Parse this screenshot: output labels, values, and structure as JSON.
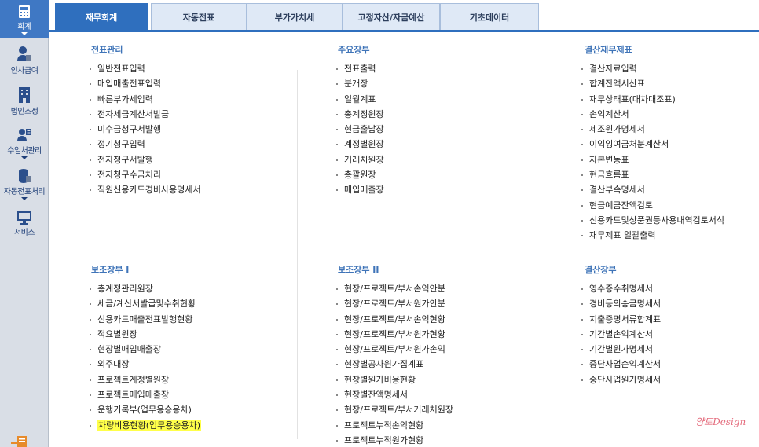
{
  "sidebar": {
    "items": [
      {
        "label": "회계",
        "icon": "calculator-icon"
      },
      {
        "label": "인사급여",
        "icon": "person-icon"
      },
      {
        "label": "법인조정",
        "icon": "building-icon"
      },
      {
        "label": "수임처관리",
        "icon": "person-card-icon"
      },
      {
        "label": "자동전표처리",
        "icon": "database-icon"
      },
      {
        "label": "서비스",
        "icon": "monitor-icon"
      }
    ]
  },
  "tabs": [
    {
      "label": "재무회계",
      "active": true
    },
    {
      "label": "자동전표"
    },
    {
      "label": "부가가치세"
    },
    {
      "label": "고정자산/자금예산"
    },
    {
      "label": "기초데이터"
    }
  ],
  "sections": {
    "journal": {
      "title": "전표관리",
      "items": [
        "일반전표입력",
        "매입매출전표입력",
        "빠른부가세입력",
        "전자세금계산서발급",
        "미수금청구서발행",
        "정기청구입력",
        "전자청구서발행",
        "전자청구수금처리",
        "직원신용카드경비사용명세서"
      ]
    },
    "main_ledger": {
      "title": "주요장부",
      "items": [
        "전표출력",
        "분개장",
        "일월계표",
        "총계정원장",
        "현금출납장",
        "계정별원장",
        "거래처원장",
        "총괄원장",
        "매입매출장"
      ]
    },
    "closing_statements": {
      "title": "결산재무제표",
      "items": [
        "결산자료입력",
        "합계잔액시산표",
        "재무상태표(대차대조표)",
        "손익계산서",
        "제조원가명세서",
        "이익잉여금처분계산서",
        "자본변동표",
        "현금흐름표",
        "결산부속명세서",
        "현금예금잔액검토",
        "신용카드및상품권등사용내역검토서식",
        "재무제표 일괄출력"
      ]
    },
    "sub_ledger_1": {
      "title": "보조장부 I",
      "items": [
        "총계정관리원장",
        "세금/계산서발급및수취현황",
        "신용카드매출전표발행현황",
        "적요별원장",
        "현장별매입매출장",
        "외주대장",
        "프로젝트계정별원장",
        "프로젝트매입매출장",
        "운행기록부(업무용승용차)",
        "차량비용현황(업무용승용차)"
      ],
      "highlighted_item": "차량비용현황(업무용승용차)"
    },
    "sub_ledger_2": {
      "title": "보조장부 II",
      "items": [
        "현장/프로젝트/부서손익안분",
        "현장/프로젝트/부서원가안분",
        "현장/프로젝트/부서손익현황",
        "현장/프로젝트/부서원가현황",
        "현장/프로젝트/부서원가손익",
        "현장별공사원가집계표",
        "현장별원가비용현황",
        "현장별잔액명세서",
        "현장/프로젝트/부서거래처원장",
        "프로젝트누적손익현황",
        "프로젝트누적원가현황"
      ]
    },
    "closing_ledger": {
      "title": "결산장부",
      "items": [
        "영수증수취명세서",
        "경비등의송금명세서",
        "지출증명서류합계표",
        "기간별손익계산서",
        "기간별원가명세서",
        "중단사업손익계산서",
        "중단사업원가명세서"
      ]
    }
  },
  "watermark": "양토Design",
  "colors": {
    "accent": "#2f6fbe",
    "section_title": "#3f74b8",
    "highlight": "#ffff4a"
  }
}
